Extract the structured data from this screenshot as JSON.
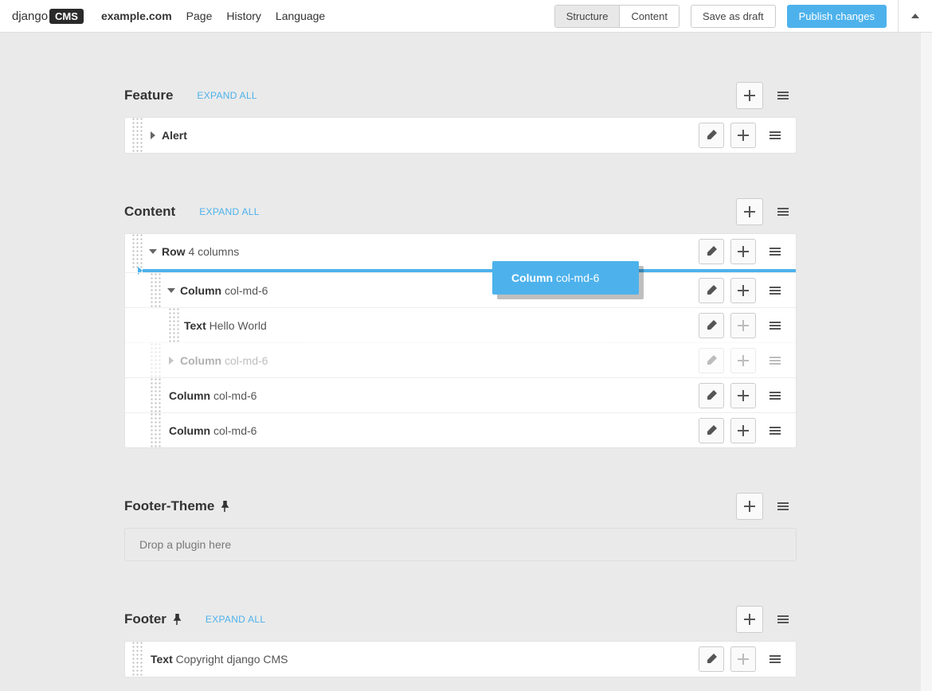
{
  "topbar": {
    "logo_prefix": "django",
    "logo_badge": "CMS",
    "site": "example.com",
    "nav": [
      "Page",
      "History",
      "Language"
    ],
    "structure": "Structure",
    "content": "Content",
    "save_draft": "Save as draft",
    "publish": "Publish changes"
  },
  "sections": {
    "feature": {
      "title": "Feature",
      "expand": "EXPAND ALL",
      "alert": {
        "label": "Alert"
      }
    },
    "content": {
      "title": "Content",
      "expand": "EXPAND ALL",
      "row": {
        "label": "Row",
        "sub": "4 columns"
      },
      "col1": {
        "label": "Column",
        "sub": "col-md-6"
      },
      "text": {
        "label": "Text",
        "sub": "Hello World"
      },
      "col_ghost": {
        "label": "Column",
        "sub": "col-md-6"
      },
      "col3": {
        "label": "Column",
        "sub": "col-md-6"
      },
      "col4": {
        "label": "Column",
        "sub": "col-md-6"
      }
    },
    "footer_theme": {
      "title": "Footer-Theme",
      "drop": "Drop a plugin here"
    },
    "footer": {
      "title": "Footer",
      "expand": "EXPAND ALL",
      "text": {
        "label": "Text",
        "sub": "Copyright django CMS"
      }
    }
  },
  "drag_ghost": {
    "label": "Column",
    "sub": "col-md-6"
  }
}
